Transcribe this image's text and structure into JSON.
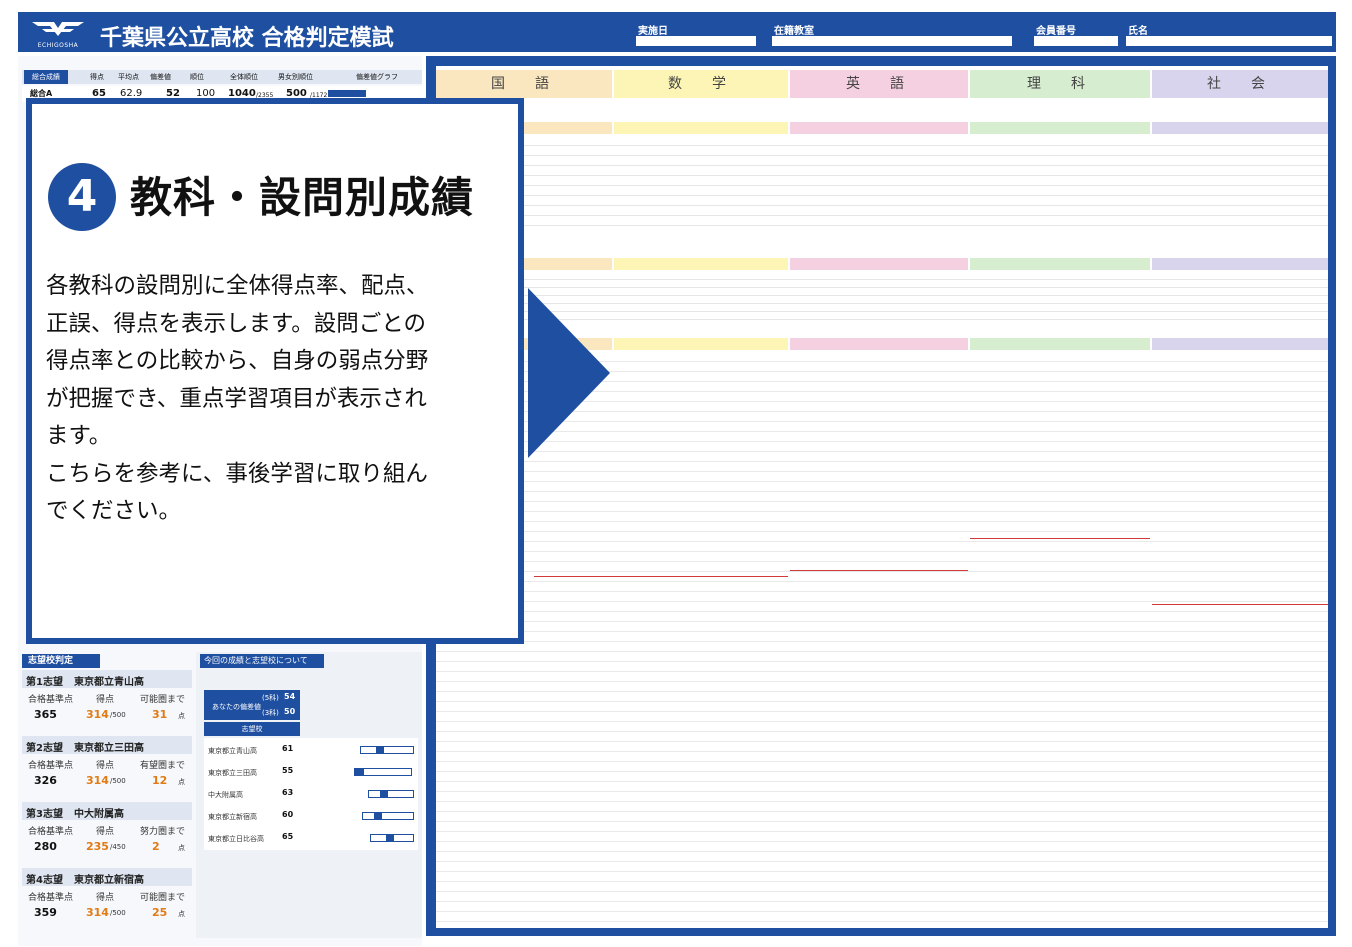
{
  "header": {
    "logo_text": "ECHIGOSHA",
    "title": "千葉県公立高校 合格判定模試",
    "fields": [
      "実施日",
      "在籍教室",
      "会員番号",
      "氏名"
    ]
  },
  "summary": {
    "chip": "総合成績",
    "columns": [
      "得点",
      "平均点",
      "偏差値",
      "順位",
      "全体順位",
      "男女別順位",
      "偏差値グラフ"
    ],
    "row": {
      "label": "総合A",
      "score": "65",
      "average": "62.9",
      "deviation": "52",
      "rank": "100",
      "overall_rank": "1040",
      "overall_total": "/2355",
      "gender_rank": "500",
      "gender_total": "/1172"
    }
  },
  "subjects": [
    "国　語",
    "数　学",
    "英　語",
    "理　科",
    "社　会"
  ],
  "callout": {
    "number": "4",
    "title": "教科・設問別成績",
    "body_lines": [
      "各教科の設問別に全体得点率、配点、",
      "正誤、得点を表示します。設問ごとの",
      "得点率との比較から、自身の弱点分野",
      "が把握でき、重点学習項目が表示され",
      "ます。",
      "こちらを参考に、事後学習に取り組ん",
      "でください。"
    ]
  },
  "shibo": {
    "chip": "志望校判定",
    "labels": {
      "pass_score": "合格基準点",
      "score": "得点",
      "unit": "点"
    },
    "schools": [
      {
        "rank": "第1志望",
        "name": "東京都立青山高",
        "pass": "365",
        "score": "314",
        "denom": "/500",
        "status": "可能圏まで",
        "gap": "31"
      },
      {
        "rank": "第2志望",
        "name": "東京都立三田高",
        "pass": "326",
        "score": "314",
        "denom": "/500",
        "status": "有望圏まで",
        "gap": "12"
      },
      {
        "rank": "第3志望",
        "name": "中大附属高",
        "pass": "280",
        "score": "235",
        "denom": "/450",
        "status": "努力圏まで",
        "gap": "2"
      },
      {
        "rank": "第4志望",
        "name": "東京都立新宿高",
        "pass": "359",
        "score": "314",
        "denom": "/500",
        "status": "可能圏まで",
        "gap": "25"
      }
    ]
  },
  "history": {
    "chip": "今回の成績と志望校について",
    "you_label": "あなたの偏差値",
    "you_values": [
      "54",
      "50"
    ],
    "you_prefixes": [
      "(5科)",
      "(3科)"
    ],
    "school_header": "志望校",
    "schools": [
      {
        "name": "東京都立青山高",
        "value": "61"
      },
      {
        "name": "東京都立三田高",
        "value": "55"
      },
      {
        "name": "中大附属高",
        "value": "63"
      },
      {
        "name": "東京都立新宿高",
        "value": "60"
      },
      {
        "name": "東京都立日比谷高",
        "value": "65"
      }
    ]
  },
  "colors": {
    "brand": "#1f4fa0",
    "kokugo": "#fbe7bf",
    "sugaku": "#fdf5b5",
    "eigo": "#f5d0e0",
    "rika": "#d6edcf",
    "shakai": "#d9d4ee",
    "accent_orange": "#e07b16"
  }
}
